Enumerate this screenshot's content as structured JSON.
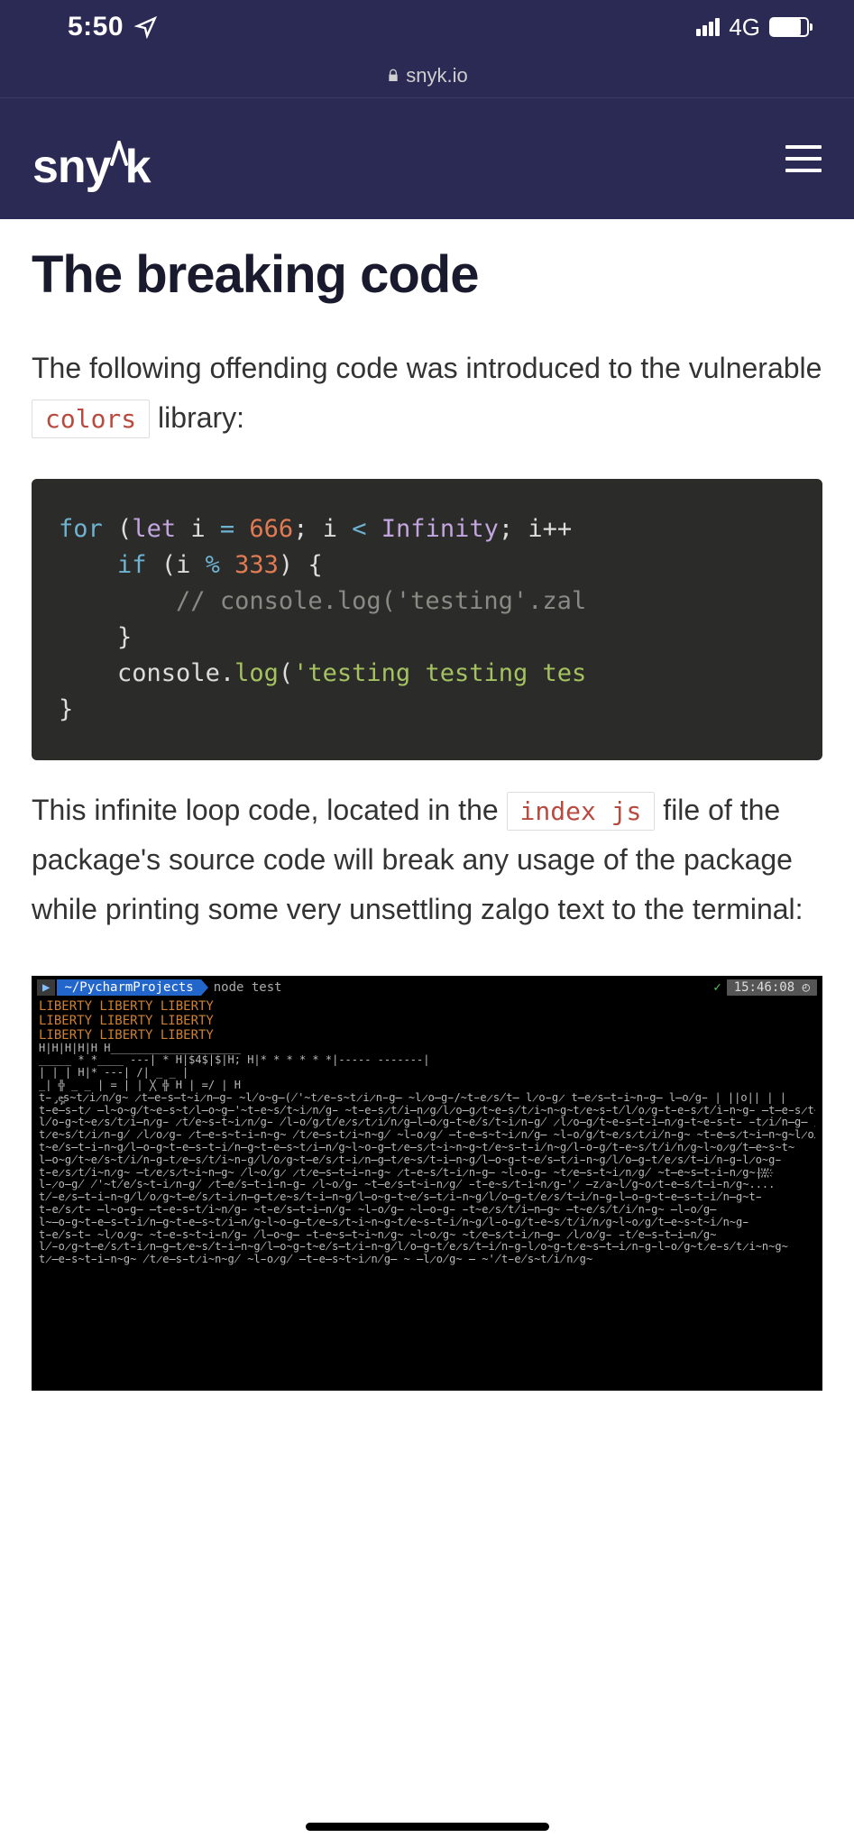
{
  "status": {
    "time": "5:50",
    "network": "4G"
  },
  "browser": {
    "domain": "snyk.io"
  },
  "header": {
    "brand": "snyk"
  },
  "article": {
    "heading": "The breaking code",
    "intro_pre": "The following offending code was introduced to the vulnerable ",
    "intro_code": "colors",
    "intro_post": " library:",
    "code": {
      "for": "for",
      "let": "let",
      "var": "i",
      "eq": "=",
      "n666": "666",
      "semi": ";",
      "lt": "<",
      "inf": "Infinity",
      "inc": "i++",
      "if": "if",
      "mod": "%",
      "n333": "333",
      "lbrace": "{",
      "rbrace": "}",
      "comment": "// console.log('testing'.zal",
      "console": "console",
      "dot": ".",
      "log": "log",
      "lparen": "(",
      "str": "'testing testing tes",
      "rparen": ")"
    },
    "para2_pre": "This infinite loop code, located in the ",
    "para2_code": "index js",
    "para2_post": " file of the package's source code will break any usage of the package while printing some very unsettling zalgo text to the terminal:"
  },
  "terminal": {
    "path": "~/PycharmProjects",
    "cmd": "node test",
    "time": "15:46:08",
    "clock_icon": "◴",
    "liberty_l1": "LIBERTY LIBERTY LIBERTY",
    "liberty_l2": "LIBERTY LIBERTY LIBERTY",
    "liberty_l3": "LIBERTY LIBERTY LIBERTY",
    "zalgo_rows": [
      "                                                        H|H|H|H|H          H____________________",
      "  _____  *  *____     ---|      *     H|$4$|$|H;         H|* * *  *  * *|-----            -------|",
      "  |               |            |      H|*                               ---|          /|  _  _ |",
      " _| ╬  _        _ |   =        |        |         ╳     ╬    H           |  =/  |          H      ",
      "t̵̡̘e̶͚s̴t̷i̷n̸g̴ ̷t̶e̵s̶t̴i̷n̶g̵ ̴l̸o̴g̶(̸'̴t̷e̵s̴t̷i̷n̵g̶ ̴l̷o̶g̵/̴t̵e̷s̸t̶   l̷o̵g̷  t̶e̷s̶t̵i̴n̵g̶   l̶o̸g̵        |   ||o||    |    |",
      "t̵e̶s̵t̷ ̶l̴o̴g̸t̴e̵s̴t̷l̶o̴g̶'̴t̵e̴s̸t̴i̷n̸g̵ ̴t̵e̵s̷t̸i̶n̷g̸l̷o̶g̷t̴e̵s̸t̷i̴n̴g̴t̷e̴s̵t̸l̸o̷g̵t̵e̵s̷t̸i̵n̴g̵ ̶t̶e̵s̷t̴i̸n̴g̶        ",
      "l̸o̵g̴t̴e̷s̸t̷i̶n̷g̵ ̷t̸e̴s̵t̴i̷n̸g̵ ̸l̵o̸g̷t̸e̷s̷t̷i̸n̷g̶l̶o̷g̵t̴e̸s̸t̴i̷n̵g̸ ̷l̷o̶g̸t̴e̵s̶t̵i̶n̷g̵t̴e̵s̵t̵ ̵t̷i̸n̶g̶   /s̴-̵     ",
      "t̷e̴s̸t̷i̷n̵g̸ ̷l̷o̷g̵ ̷t̶e̵s̴t̵i̵n̴g̴ ̸t̷e̶s̵t̷i̴n̴g̸ ̴l̵o̷g̸ ̶t̵e̶s̴t̴i̷n̸g̶ ̴l̵o̸g̸t̴e̷s̷t̷i̸n̵g̴ ̴t̵e̶s̷t̴i̶n̴g̴l̷o̸g̴   t̶9̷.̵9̴  ",
      "t̴e̸s̶t̵i̵n̴g̸l̶o̵g̴t̵e̶s̵t̵i̸n̶g̴t̵e̶s̴t̷i̶n̸g̴l̴o̵g̶t̷e̶s̷t̴i̴n̴g̴t̸e̴s̵t̵i̸n̴g̸l̵o̵g̸t̵e̴s̸t̸i̸n̷g̴l̴o̷g̸t̶e̴s̴t̴           ",
      "l̶o̴g̸t̴e̸s̴t̸i̸n̵g̵t̷e̶s̸t̸i̴n̵g̸l̸o̷g̴t̶e̸s̷t̵i̷n̶g̶t̷e̴s̸t̵i̶n̴g̸l̶o̴g̵t̴e̸s̶t̷i̵n̴g̸l̸o̶g̵t̸e̷s̸t̶i̸n̵g̵l̷o̴g̵           ",
      "t̵e̷s̷t̸i̴n̷g̴ ̶t̷e̷s̷t̴i̴n̶g̴ ̸l̴o̸g̷ ̷t̷e̶s̶t̶i̵n̵g̴ ̷t̵e̵s̸t̵i̷n̵g̶ ̴l̵o̵g̵ ̴t̷e̶s̵t̴i̷n̷g̸ ̴t̶e̴s̶t̵i̵n̷g̴|҉/҉/҉           ",
      "  l̵̷o̶g̸ ̸'̴t̸e̸s̴t̵i̷n̵g̸ ̷t̶e̸s̶t̵i̵n̵g̵ ̷l̴o̸g̵ ̴t̶e̷s̶t̴i̵n̷g̸ ̵t̵e̴s̷t̵i̴n̷g̵'̷ ̶z̷a̴l̸g̴o̷t̵e̶s̷t̶i̵n̷g̴....          ",
      "t̸̵e̷s̶t̵i̵n̴g̸l̸o̷g̴t̶e̸s̷t̵i̷n̶g̶t̷e̴s̸t̵i̶n̴g̸l̶o̴g̵t̴e̸s̶t̷i̵n̴g̸l̸o̶g̵t̸e̷s̸t̶i̸n̵g̵l̶o̵g̴t̵e̶s̵t̵i̸n̶g̴t̵           ",
      "t̵e̸s̷t̵ ̶l̴o̵g̶ ̶t̵e̵s̵t̸i̴n̸g̵ ̴t̵e̸s̶t̵i̶n̸g̵ ̴l̵o̸g̶ ̴l̶o̵g̵ ̵t̴e̷s̸t̸i̶n̶g̴ ̶t̴e̸s̸t̸i̸n̵g̴ ̶l̵o̸g̶                ",
      "l̴̶o̵g̴t̵e̶s̵t̵i̸n̶g̴t̵e̶s̴t̷i̶n̸g̴l̴o̵g̶t̷e̶s̷t̴i̴n̴g̴t̸e̴s̵t̵i̸n̴g̸l̵o̵g̸t̵e̴s̸t̸i̸n̷g̴l̴o̷g̸t̶e̴s̴t̴i̸n̴g̵           ",
      "t̵e̸s̵t̵ ̴l̷o̷g̴ ̴t̵e̵s̴t̴i̵n̸g̵ ̸l̶o̴g̶ ̵t̵e̴s̶t̴i̴n̷g̴ ̴l̴o̷g̴ ̴t̷e̶s̷t̵i̷n̶g̶ ̷l̷o̸g̵ ̵t̸e̶s̵t̶i̶n̸g̴                ",
      "l̸̵o̷g̴t̶e̸s̷t̵i̷n̶g̶t̷e̴s̸t̵i̶n̴g̸l̶o̴g̵t̴e̸s̶t̷i̵n̴g̸l̸o̶g̵t̸e̷s̸t̶i̸n̵g̵l̷o̴g̵t̷e̴s̶t̶i̷n̵g̵l̵o̸g̴t̷e̵s̸t̷i̴n̴g̴",
      "t̷̶e̵s̴t̵i̵n̴g̴     ̸t̷e̶s̵t̷i̴n̴g̸ ̴l̵o̷g̸ ̶t̵e̶s̴t̴i̷n̸g̶ ̴ ̶l̷o̸g̴ ̶  ̴'̸t̵e̸s̴t̸i̸n̷g̴"
    ]
  }
}
